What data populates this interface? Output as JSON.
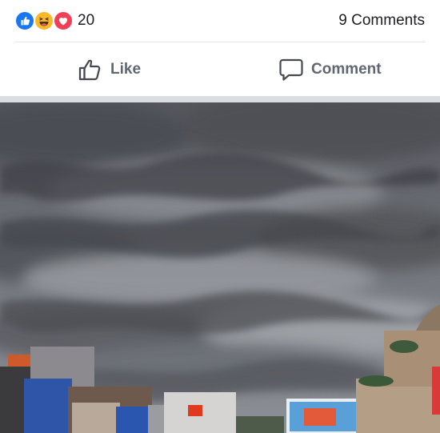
{
  "reactions": {
    "types": [
      {
        "name": "like",
        "icon": "thumbs-up-icon",
        "color": "#1877f2"
      },
      {
        "name": "haha",
        "icon": "laughing-face-icon",
        "color": "#f7b928"
      },
      {
        "name": "love",
        "icon": "heart-icon",
        "color": "#f33e58"
      }
    ],
    "count": "20"
  },
  "comments": {
    "count_label": "9 Comments"
  },
  "actions": {
    "like_label": "Like",
    "comment_label": "Comment",
    "label_color": "#606770"
  },
  "photo": {
    "subject": "storm-clouds-over-city-icon"
  }
}
